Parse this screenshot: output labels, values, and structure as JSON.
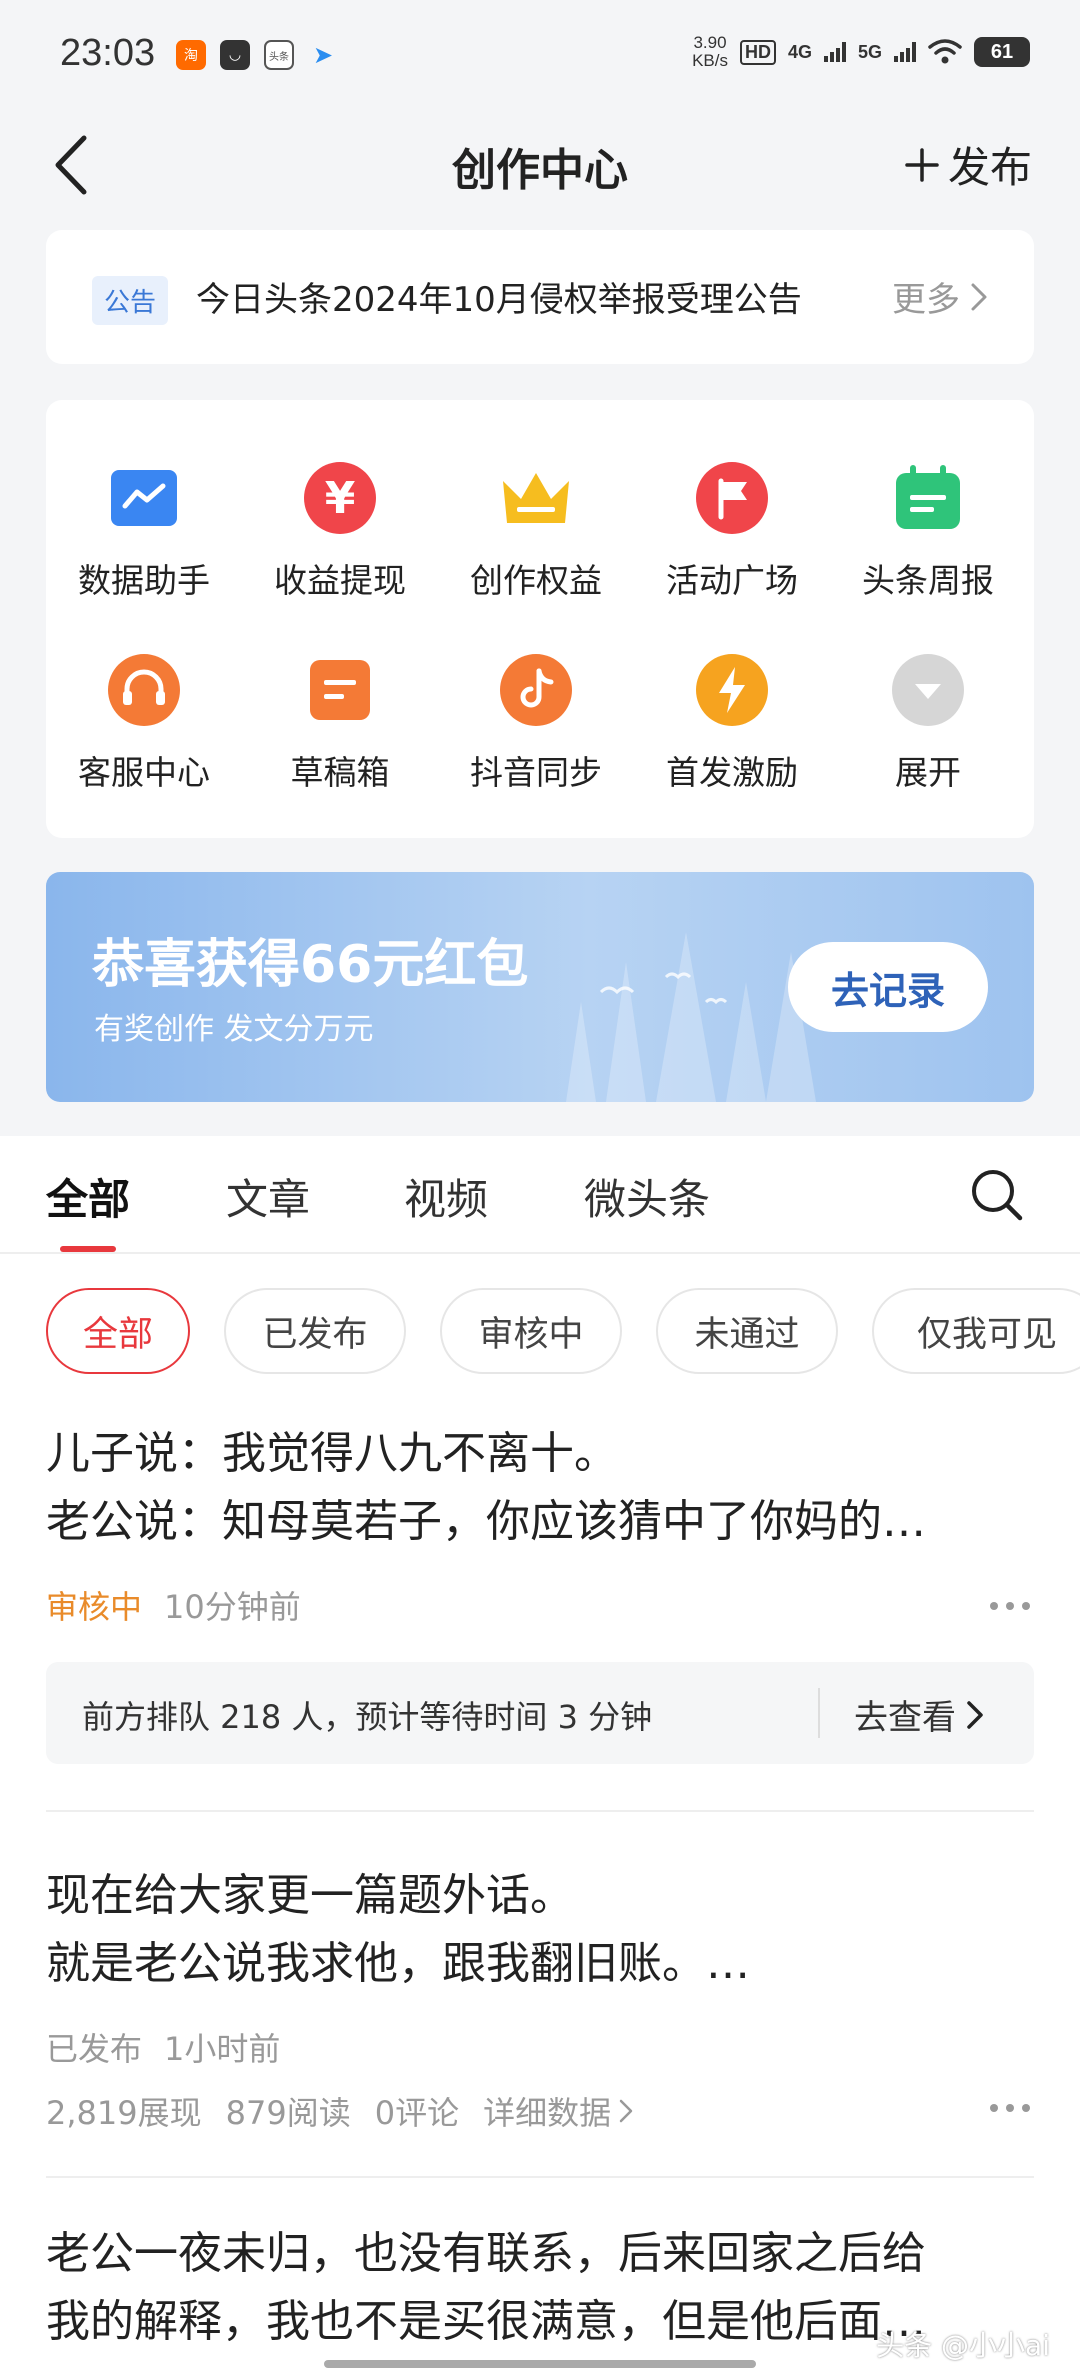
{
  "status_bar": {
    "time": "23:03",
    "apps": [
      {
        "icon": "taobao-icon",
        "glyph": "淘",
        "color": "#ff6a00"
      },
      {
        "icon": "message-icon",
        "glyph": "◡",
        "color": "#333333"
      },
      {
        "icon": "toutiao-icon",
        "glyph": "头条",
        "color": "#666666"
      },
      {
        "icon": "send-icon",
        "glyph": "➤",
        "color": "#2a8df0"
      }
    ],
    "speed_value": "3.90",
    "speed_unit": "KB/s",
    "hd": "HD",
    "net1": "4G",
    "net2": "5G",
    "battery": "61"
  },
  "nav": {
    "title": "创作中心",
    "publish_label": "发布"
  },
  "notice": {
    "tag": "公告",
    "text": "今日头条2024年10月侵权举报受理公告",
    "more": "更多"
  },
  "tools": [
    {
      "label": "数据助手",
      "icon": "data-chart-icon",
      "color": "#3a86f2"
    },
    {
      "label": "收益提现",
      "icon": "yuan-coin-icon",
      "color": "#f0454a"
    },
    {
      "label": "创作权益",
      "icon": "crown-icon",
      "color": "#f6bd1f"
    },
    {
      "label": "活动广场",
      "icon": "flag-icon",
      "color": "#f0454a"
    },
    {
      "label": "头条周报",
      "icon": "calendar-icon",
      "color": "#2fc47a"
    },
    {
      "label": "客服中心",
      "icon": "headset-icon",
      "color": "#f47a36"
    },
    {
      "label": "草稿箱",
      "icon": "draft-icon",
      "color": "#f47a36"
    },
    {
      "label": "抖音同步",
      "icon": "douyin-icon",
      "color": "#f47a36"
    },
    {
      "label": "首发激励",
      "icon": "lightning-icon",
      "color": "#f6a31f"
    },
    {
      "label": "展开",
      "icon": "expand-icon",
      "color": "#d6d6d6"
    }
  ],
  "banner": {
    "title": "恭喜获得66元红包",
    "subtitle": "有奖创作 发文分万元",
    "button": "去记录"
  },
  "tabs": [
    "全部",
    "文章",
    "视频",
    "微头条"
  ],
  "filters": [
    "全部",
    "已发布",
    "审核中",
    "未通过",
    "仅我可见"
  ],
  "posts": [
    {
      "line1": "儿子说：我觉得八九不离十。",
      "line2": "老公说：知母莫若子，你应该猜中了你妈的…",
      "status": "审核中",
      "time": "10分钟前",
      "queue_text": "前方排队 218 人，预计等待时间 3 分钟",
      "queue_link": "去查看"
    },
    {
      "line1": "现在给大家更一篇题外话。",
      "line2": "就是老公说我求他，跟我翻旧账。…",
      "status": "已发布",
      "time": "1小时前",
      "impressions": "2,819展现",
      "reads": "879阅读",
      "comments": "0评论",
      "detail": "详细数据"
    },
    {
      "line1": "老公一夜未归，也没有联系，后来回家之后给",
      "line2": "我的解释，我也不是买很满意，但是他后面…"
    }
  ],
  "watermark": "头条 @小小ai"
}
